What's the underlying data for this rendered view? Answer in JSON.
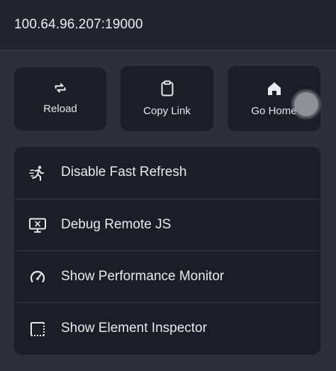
{
  "header": {
    "url": "100.64.96.207:19000"
  },
  "actions": [
    {
      "label": "Reload",
      "icon": "reload-icon"
    },
    {
      "label": "Copy Link",
      "icon": "clipboard-icon"
    },
    {
      "label": "Go Home",
      "icon": "home-icon"
    }
  ],
  "menu": {
    "items": [
      {
        "label": "Disable Fast Refresh",
        "icon": "running-person-icon"
      },
      {
        "label": "Debug Remote JS",
        "icon": "monitor-debug-icon"
      },
      {
        "label": "Show Performance Monitor",
        "icon": "speedometer-icon"
      },
      {
        "label": "Show Element Inspector",
        "icon": "inspector-square-icon"
      }
    ]
  },
  "colors": {
    "sheet_background": "#22252e",
    "card_background": "#1b1e26",
    "text": "#e9eaee"
  }
}
